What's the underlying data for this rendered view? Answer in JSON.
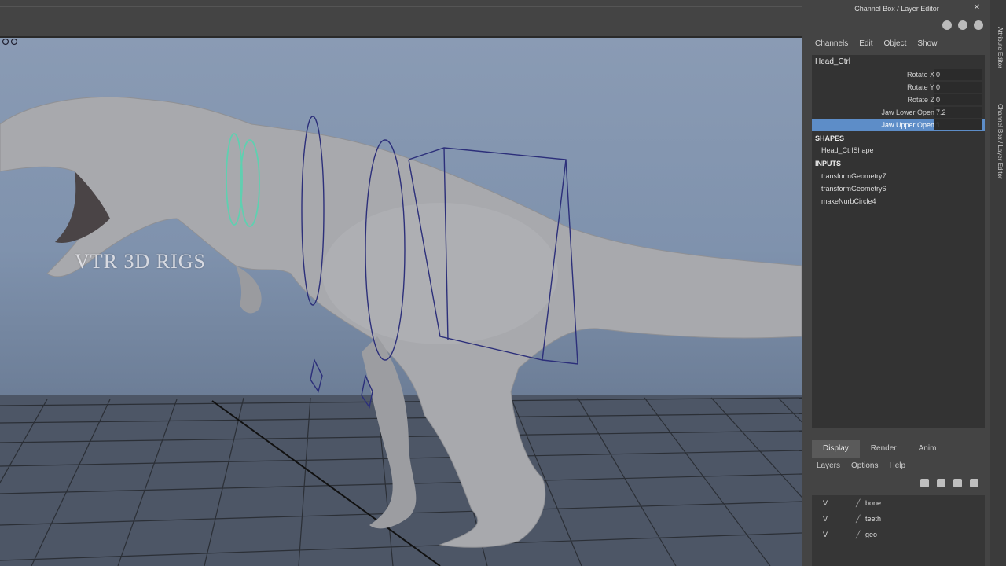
{
  "panel": {
    "title": "Channel Box / Layer Editor",
    "menu": [
      "Channels",
      "Edit",
      "Object",
      "Show"
    ],
    "node_name": "Head_Ctrl",
    "attributes": [
      {
        "label": "Rotate X",
        "value": "0"
      },
      {
        "label": "Rotate Y",
        "value": "0"
      },
      {
        "label": "Rotate Z",
        "value": "0"
      },
      {
        "label": "Jaw Lower Open",
        "value": "7.2"
      },
      {
        "label": "Jaw Upper Open",
        "value": "1",
        "selected": true
      }
    ],
    "shapes_header": "SHAPES",
    "shapes": [
      "Head_CtrlShape"
    ],
    "inputs_header": "INPUTS",
    "inputs": [
      "transformGeometry7",
      "transformGeometry6",
      "makeNurbCircle4"
    ]
  },
  "layers": {
    "tabs": [
      "Display",
      "Render",
      "Anim"
    ],
    "active_tab": "Display",
    "menu": [
      "Layers",
      "Options",
      "Help"
    ],
    "items": [
      {
        "visible": "V",
        "name": "bone"
      },
      {
        "visible": "V",
        "name": "teeth"
      },
      {
        "visible": "V",
        "name": "geo"
      }
    ]
  },
  "side_tabs": [
    "Attribute Editor",
    "Channel Box / Layer Editor"
  ],
  "viewport": {
    "watermark": "VTR 3D RIGS"
  },
  "colors": {
    "selection": "#5d8dc8",
    "control_green": "#5fd0b0",
    "control_blue": "#2c2f7a"
  }
}
